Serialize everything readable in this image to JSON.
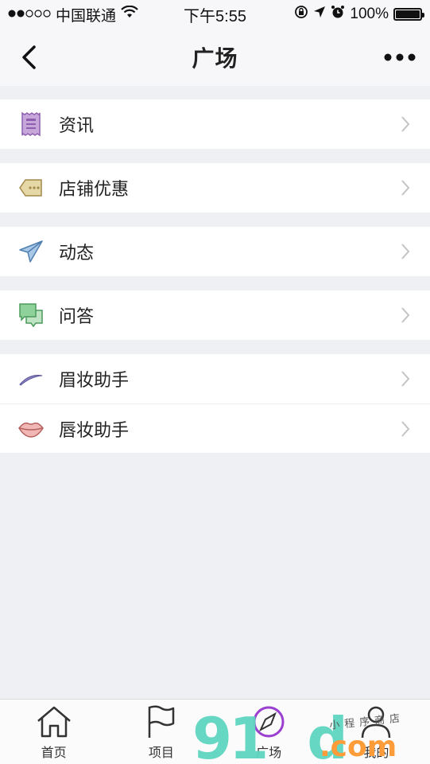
{
  "status": {
    "carrier": "中国联通",
    "time": "下午5:55",
    "battery": "100%",
    "battery_level": 1.0
  },
  "nav": {
    "title": "广场"
  },
  "groups": [
    [
      {
        "label": "资讯",
        "icon": "news-icon"
      }
    ],
    [
      {
        "label": "店铺优惠",
        "icon": "coupon-icon"
      }
    ],
    [
      {
        "label": "动态",
        "icon": "paper-plane-icon"
      }
    ],
    [
      {
        "label": "问答",
        "icon": "chat-bubbles-icon"
      }
    ],
    [
      {
        "label": "眉妆助手",
        "icon": "eyebrow-icon"
      },
      {
        "label": "唇妆助手",
        "icon": "lips-icon"
      }
    ]
  ],
  "tabs": [
    {
      "label": "首页",
      "icon": "home-icon"
    },
    {
      "label": "项目",
      "icon": "flag-icon"
    },
    {
      "label": "广场",
      "icon": "compass-icon"
    },
    {
      "label": "我的",
      "icon": "user-icon"
    }
  ],
  "watermark": {
    "digits": "91",
    "tail": "d",
    "com": ".com",
    "small": "小程序商店"
  },
  "colors": {
    "bar_bg": "#f7f7f9",
    "page_bg": "#eff0f4",
    "watermark_teal": "#5fd6c0",
    "watermark_orange": "#ff9c3a"
  }
}
